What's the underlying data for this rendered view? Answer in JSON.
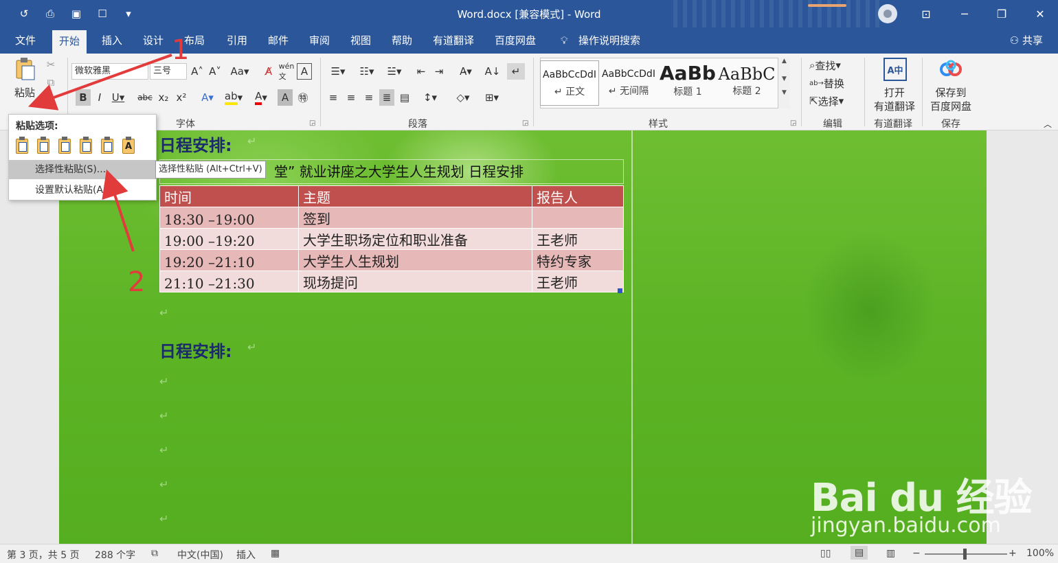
{
  "title": "Word.docx [兼容模式]  -  Word",
  "quick_access": [
    "undo-icon",
    "print-preview-icon",
    "save-icon",
    "touch-mode-icon",
    "customize-qat-icon"
  ],
  "menu_tabs": [
    "文件",
    "开始",
    "插入",
    "设计",
    "布局",
    "引用",
    "邮件",
    "审阅",
    "视图",
    "帮助",
    "有道翻译",
    "百度网盘"
  ],
  "tell_me": "操作说明搜索",
  "share": "共享",
  "ribbon": {
    "paste": "粘贴",
    "font_name": "微软雅黑",
    "font_size": "三号",
    "group_font": "字体",
    "group_paragraph": "段落",
    "group_styles": "样式",
    "group_edit": "编辑",
    "group_youdao": "有道翻译",
    "group_save": "保存",
    "styles": [
      {
        "sample": "AaBbCcDdI",
        "name": "↵ 正文"
      },
      {
        "sample": "AaBbCcDdI",
        "name": "↵ 无间隔"
      },
      {
        "sample": "AaBb",
        "name": "标题 1"
      },
      {
        "sample": "AaBbC",
        "name": "标题 2"
      }
    ],
    "find": "查找",
    "replace": "替换",
    "select": "选择",
    "youdao_line1": "打开",
    "youdao_line2": "有道翻译",
    "baidu_line1": "保存到",
    "baidu_line2": "百度网盘"
  },
  "paste_menu": {
    "title": "粘贴选项:",
    "item_special": "选择性粘贴(S)...",
    "item_default": "设置默认粘贴(A)...",
    "tooltip": "选择性粘贴 (Alt+Ctrl+V)"
  },
  "document": {
    "heading1": "日程安排:",
    "caption": "堂” 就业讲座之大学生人生规划 日程安排",
    "table_headers": [
      "时间",
      "主题",
      "报告人"
    ],
    "table_rows": [
      [
        "18:30 –19:00",
        "签到",
        ""
      ],
      [
        "19:00 –19:20",
        "大学生职场定位和职业准备",
        "王老师"
      ],
      [
        "19:20 –21:10",
        "大学生人生规划",
        "特约专家"
      ],
      [
        "21:10 –21:30",
        "现场提问",
        "王老师"
      ]
    ],
    "heading2": "日程安排:"
  },
  "annotations": [
    "1",
    "2"
  ],
  "watermark": {
    "logo": "Bai du 经验",
    "url": "jingyan.baidu.com"
  },
  "status": {
    "page": "第 3 页，共 5 页",
    "words": "288 个字",
    "language": "中文(中国)",
    "mode": "插入",
    "zoom": "100%"
  },
  "colors": {
    "accent": "#2b579a",
    "table_header": "#c0504d",
    "annotation": "#e23b3b"
  }
}
